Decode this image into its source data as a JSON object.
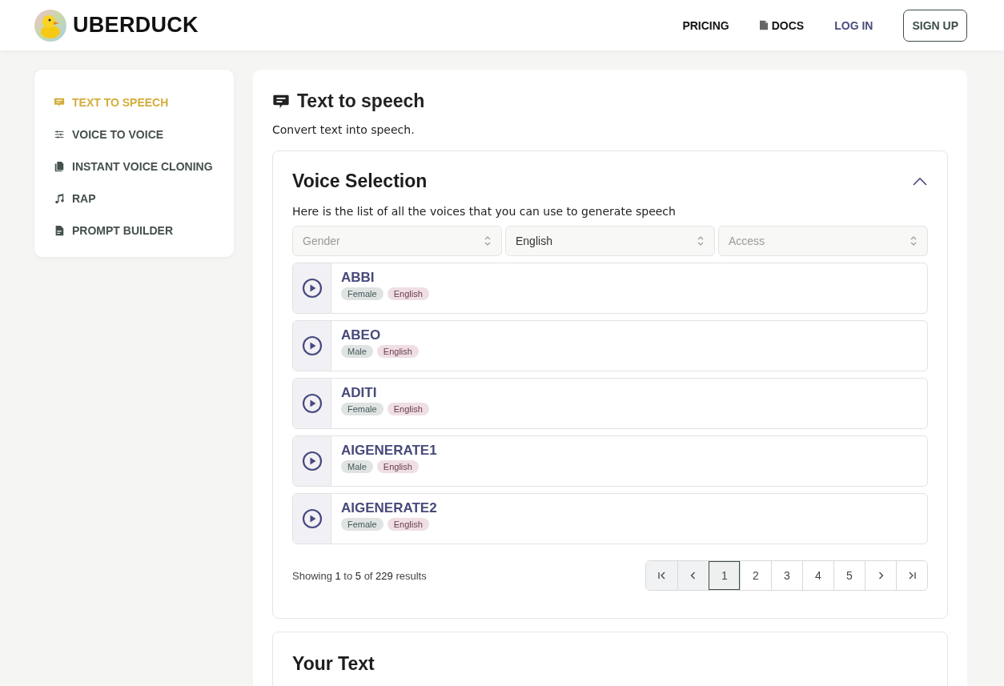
{
  "header": {
    "brand": "UBERDUCK",
    "nav": [
      "PRICING",
      "DOCS",
      "LOG IN"
    ],
    "signup": "SIGN UP"
  },
  "sidebar": {
    "items": [
      {
        "label": "TEXT TO SPEECH",
        "selected": true
      },
      {
        "label": "VOICE TO VOICE",
        "selected": false
      },
      {
        "label": "INSTANT VOICE CLONING",
        "selected": false
      },
      {
        "label": "RAP",
        "selected": false
      },
      {
        "label": "PROMPT BUILDER",
        "selected": false
      }
    ]
  },
  "page": {
    "title": "Text to speech",
    "subtitle": "Convert text into speech."
  },
  "voice_selection": {
    "title": "Voice Selection",
    "expanded": true,
    "description": "Here is the list of all the voices that you can use to generate speech",
    "filters": [
      {
        "placeholder": "Gender"
      },
      {
        "value": "English"
      },
      {
        "placeholder": "Access"
      }
    ],
    "voices": [
      {
        "name": "ABBI",
        "tags": [
          {
            "label": "Female",
            "kind": "gender"
          },
          {
            "label": "English",
            "kind": "language"
          }
        ]
      },
      {
        "name": "ABEO",
        "tags": [
          {
            "label": "Male",
            "kind": "gender"
          },
          {
            "label": "English",
            "kind": "language"
          }
        ]
      },
      {
        "name": "ADITI",
        "tags": [
          {
            "label": "Female",
            "kind": "gender"
          },
          {
            "label": "English",
            "kind": "language"
          }
        ]
      },
      {
        "name": "AIGENERATE1",
        "tags": [
          {
            "label": "Male",
            "kind": "gender"
          },
          {
            "label": "English",
            "kind": "language"
          }
        ]
      },
      {
        "name": "AIGENERATE2",
        "tags": [
          {
            "label": "Female",
            "kind": "gender"
          },
          {
            "label": "English",
            "kind": "language"
          }
        ]
      }
    ],
    "summary": "Showing **1** to **5** of **229** results",
    "pages": [
      {
        "label": "1",
        "selected": true
      },
      {
        "label": "2",
        "selected": false
      },
      {
        "label": "3",
        "selected": false
      },
      {
        "label": "4",
        "selected": false
      },
      {
        "label": "5",
        "selected": false
      }
    ]
  },
  "your_text": {
    "title": "Your Text"
  }
}
